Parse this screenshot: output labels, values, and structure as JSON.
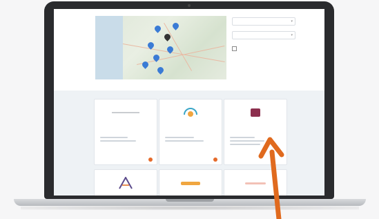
{
  "colors": {
    "accent": "#3a7bd5",
    "arrow": "#e06a1e",
    "action": "#e56b2b",
    "link": "#4a90c8"
  },
  "icons": {
    "map_pin": "map-pin-icon",
    "chevron": "chevron-down-icon",
    "arrow": "orange-pointer-arrow"
  },
  "filters": {
    "select1": "",
    "select2": "",
    "checkbox_text": ""
  },
  "cards": [
    {
      "title": "",
      "sub": "",
      "footer": ""
    },
    {
      "title": "",
      "sub": "",
      "footer": ""
    },
    {
      "title": "",
      "sub": "",
      "footer": ""
    },
    {
      "title": ""
    },
    {
      "title": ""
    },
    {
      "title": ""
    }
  ]
}
